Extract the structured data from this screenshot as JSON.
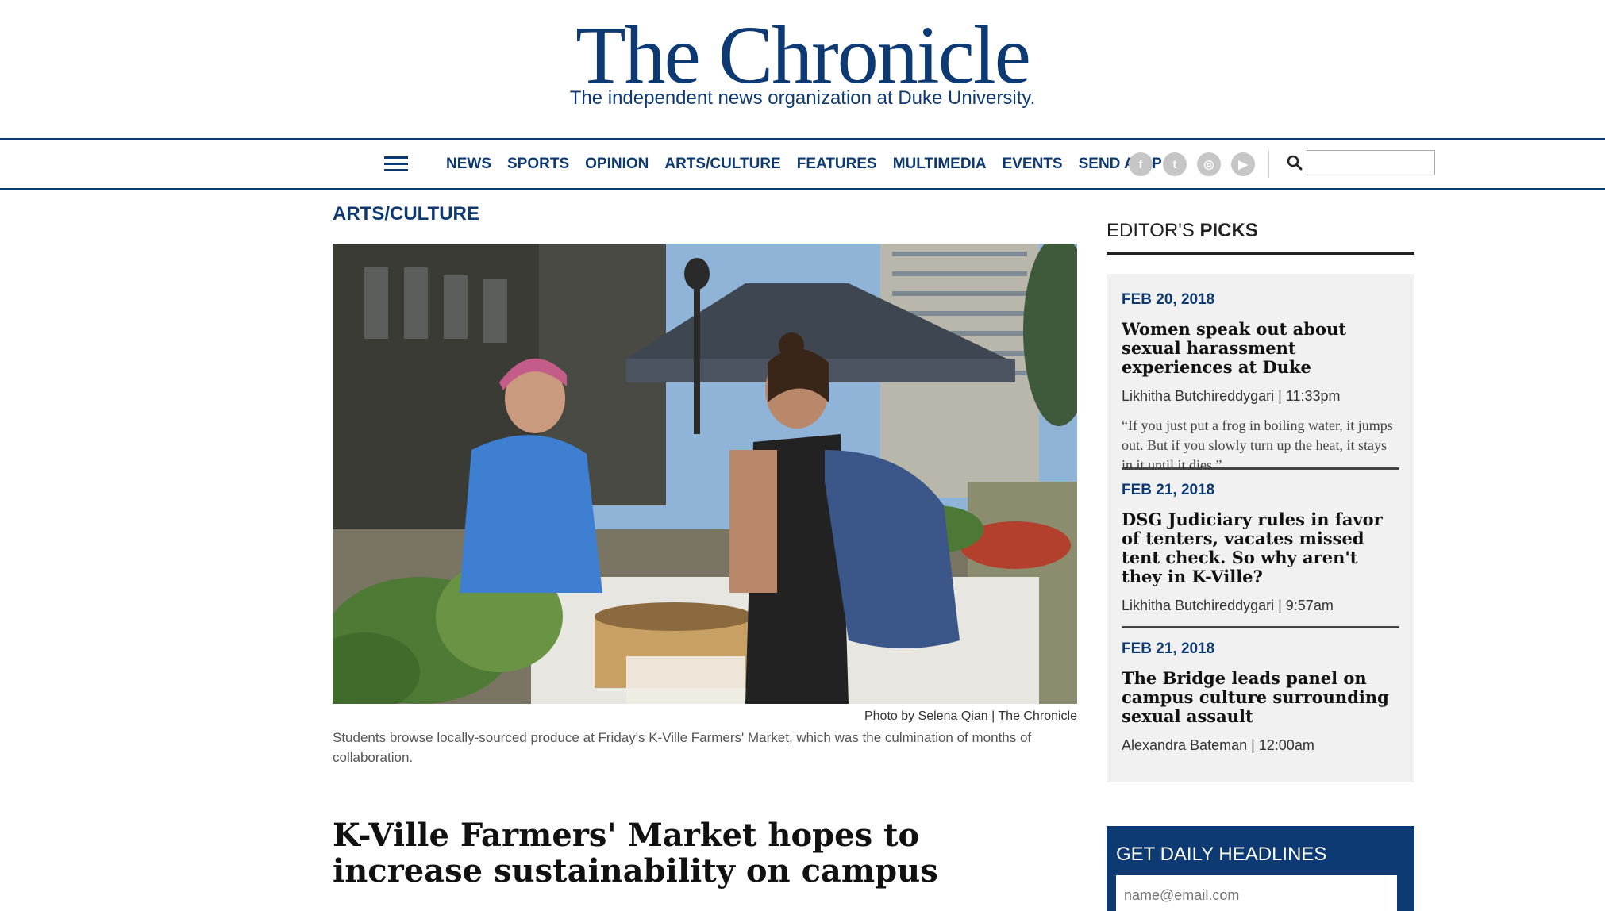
{
  "masthead": {
    "logo": "The Chronicle",
    "tagline": "The independent news organization at Duke University."
  },
  "nav": {
    "items": [
      "NEWS",
      "SPORTS",
      "OPINION",
      "ARTS/CULTURE",
      "FEATURES",
      "MULTIMEDIA",
      "EVENTS",
      "SEND A TIP"
    ],
    "social": [
      {
        "icon": "facebook-icon",
        "glyph": "f"
      },
      {
        "icon": "twitter-icon",
        "glyph": "t"
      },
      {
        "icon": "instagram-icon",
        "glyph": "◎"
      },
      {
        "icon": "youtube-icon",
        "glyph": "▶"
      }
    ],
    "search_value": ""
  },
  "article": {
    "section": "ARTS/CULTURE",
    "photo_credit": "Photo by Selena Qian | The Chronicle",
    "caption": "Students browse locally-sourced produce at Friday's K-Ville Farmers' Market, which was the culmination of months of collaboration.",
    "headline": "K-Ville Farmers' Market hopes to increase sustainability on campus"
  },
  "sidebar": {
    "picks_title_prefix": "EDITOR'S ",
    "picks_title_bold": "PICKS",
    "picks": [
      {
        "date": "FEB 20, 2018",
        "title": "Women speak out about sexual harassment experiences at Duke",
        "byline": "Likhitha Butchireddygari | 11:33pm",
        "quote": "“If you just put a frog in boiling water, it jumps out. But if you slowly turn up the heat, it stays in it until it dies.”"
      },
      {
        "date": "FEB 21, 2018",
        "title": "DSG Judiciary rules in favor of tenters, vacates missed tent check. So why aren't they in K-Ville?",
        "byline": "Likhitha Butchireddygari | 9:57am"
      },
      {
        "date": "FEB 21, 2018",
        "title": "The Bridge leads panel on campus culture surrounding sexual assault",
        "byline": "Alexandra Bateman | 12:00am"
      }
    ],
    "headlines_title": "GET DAILY HEADLINES",
    "email_placeholder": "name@email.com"
  },
  "colors": {
    "brand_navy": "#0d3a73",
    "social_grey": "#c6c6c6",
    "sidebar_bg": "#f1f1f1"
  }
}
